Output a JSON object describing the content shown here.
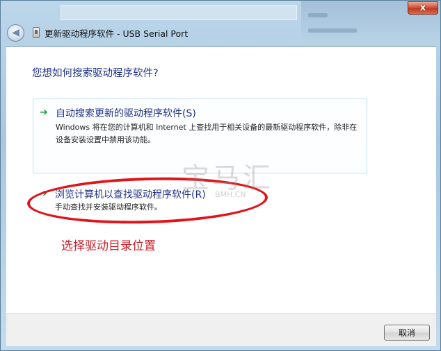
{
  "window": {
    "title": "更新驱动程序软件 - USB Serial Port",
    "close_glyph": "x"
  },
  "content": {
    "question": "您想如何搜索驱动程序软件?",
    "options": [
      {
        "title": "自动搜索更新的驱动程序软件(S)",
        "description": "Windows 将在您的计算机和 Internet 上查找用于相关设备的最新驱动程序软件，除非在设备安装设置中禁用该功能。"
      },
      {
        "title": "浏览计算机以查找驱动程序软件(R)",
        "description": "手动查找并安装驱动程序软件。"
      }
    ],
    "annotation": "选择驱动目录位置",
    "watermark": "宝马汇",
    "watermark_sub": "BMH.CN"
  },
  "footer": {
    "cancel_label": "取消"
  },
  "colors": {
    "accent_link": "#1e3287",
    "arrow_green": "#1aa33b",
    "annotation_red": "#e0141b"
  }
}
